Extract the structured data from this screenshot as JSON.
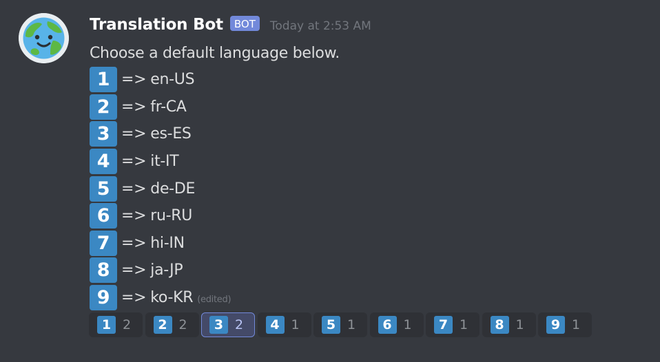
{
  "message": {
    "author": "Translation Bot",
    "bot_tag": "BOT",
    "timestamp": "Today at 2:53 AM",
    "intro": "Choose a default language below.",
    "arrow": "=>",
    "edited_label": "(edited)",
    "options": [
      {
        "number": "1",
        "lang": "en-US"
      },
      {
        "number": "2",
        "lang": "fr-CA"
      },
      {
        "number": "3",
        "lang": "es-ES"
      },
      {
        "number": "4",
        "lang": "it-IT"
      },
      {
        "number": "5",
        "lang": "de-DE"
      },
      {
        "number": "6",
        "lang": "ru-RU"
      },
      {
        "number": "7",
        "lang": "hi-IN"
      },
      {
        "number": "8",
        "lang": "ja-JP"
      },
      {
        "number": "9",
        "lang": "ko-KR"
      }
    ]
  },
  "avatar": {
    "icon": "globe-smiley-icon"
  },
  "reactions": [
    {
      "emoji": "1",
      "count": "2",
      "selected": false
    },
    {
      "emoji": "2",
      "count": "2",
      "selected": false
    },
    {
      "emoji": "3",
      "count": "2",
      "selected": true
    },
    {
      "emoji": "4",
      "count": "1",
      "selected": false
    },
    {
      "emoji": "5",
      "count": "1",
      "selected": false
    },
    {
      "emoji": "6",
      "count": "1",
      "selected": false
    },
    {
      "emoji": "7",
      "count": "1",
      "selected": false
    },
    {
      "emoji": "8",
      "count": "1",
      "selected": false
    },
    {
      "emoji": "9",
      "count": "1",
      "selected": false
    }
  ],
  "colors": {
    "background": "#36393f",
    "keycap": "#3b88c3",
    "bot_tag": "#7289da",
    "reaction_bg": "#2f3136",
    "reaction_selected_bg": "#444a68"
  }
}
